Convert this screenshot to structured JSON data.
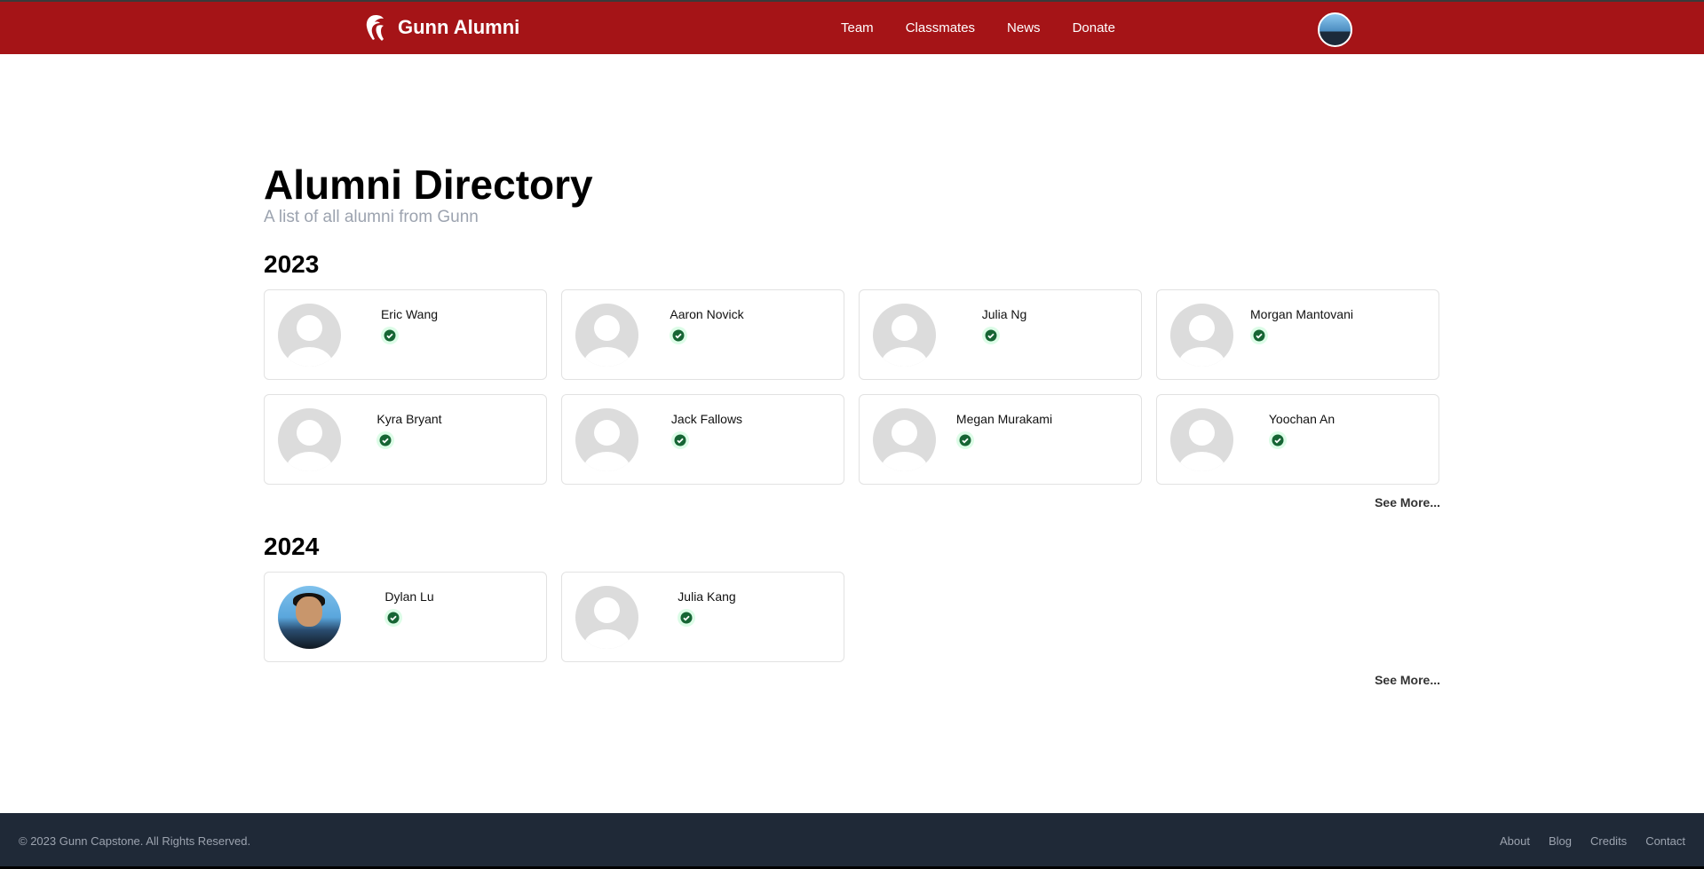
{
  "header": {
    "title": "Gunn Alumni",
    "nav": [
      "Team",
      "Classmates",
      "News",
      "Donate"
    ]
  },
  "main": {
    "title": "Alumni Directory",
    "subtitle": "A list of all alumni from Gunn",
    "sections": [
      {
        "year": "2023",
        "see_more": "See More...",
        "alumni": [
          {
            "name": "Eric Wang",
            "verified": true
          },
          {
            "name": "Aaron Novick",
            "verified": true
          },
          {
            "name": "Julia Ng",
            "verified": true
          },
          {
            "name": "Morgan Mantovani",
            "verified": true
          },
          {
            "name": "Kyra Bryant",
            "verified": true
          },
          {
            "name": "Jack Fallows",
            "verified": true
          },
          {
            "name": "Megan Murakami",
            "verified": true
          },
          {
            "name": "Yoochan An",
            "verified": true
          }
        ]
      },
      {
        "year": "2024",
        "see_more": "See More...",
        "alumni": [
          {
            "name": "Dylan Lu",
            "verified": true,
            "photo": true
          },
          {
            "name": "Julia Kang",
            "verified": true
          }
        ]
      }
    ]
  },
  "footer": {
    "copyright": "© 2023 Gunn Capstone. All Rights Reserved.",
    "links": [
      "About",
      "Blog",
      "Credits",
      "Contact"
    ]
  },
  "colors": {
    "header": "#a51417",
    "footer": "#1f2937",
    "badge": "#166534",
    "badge_bg": "#dcfce7"
  }
}
